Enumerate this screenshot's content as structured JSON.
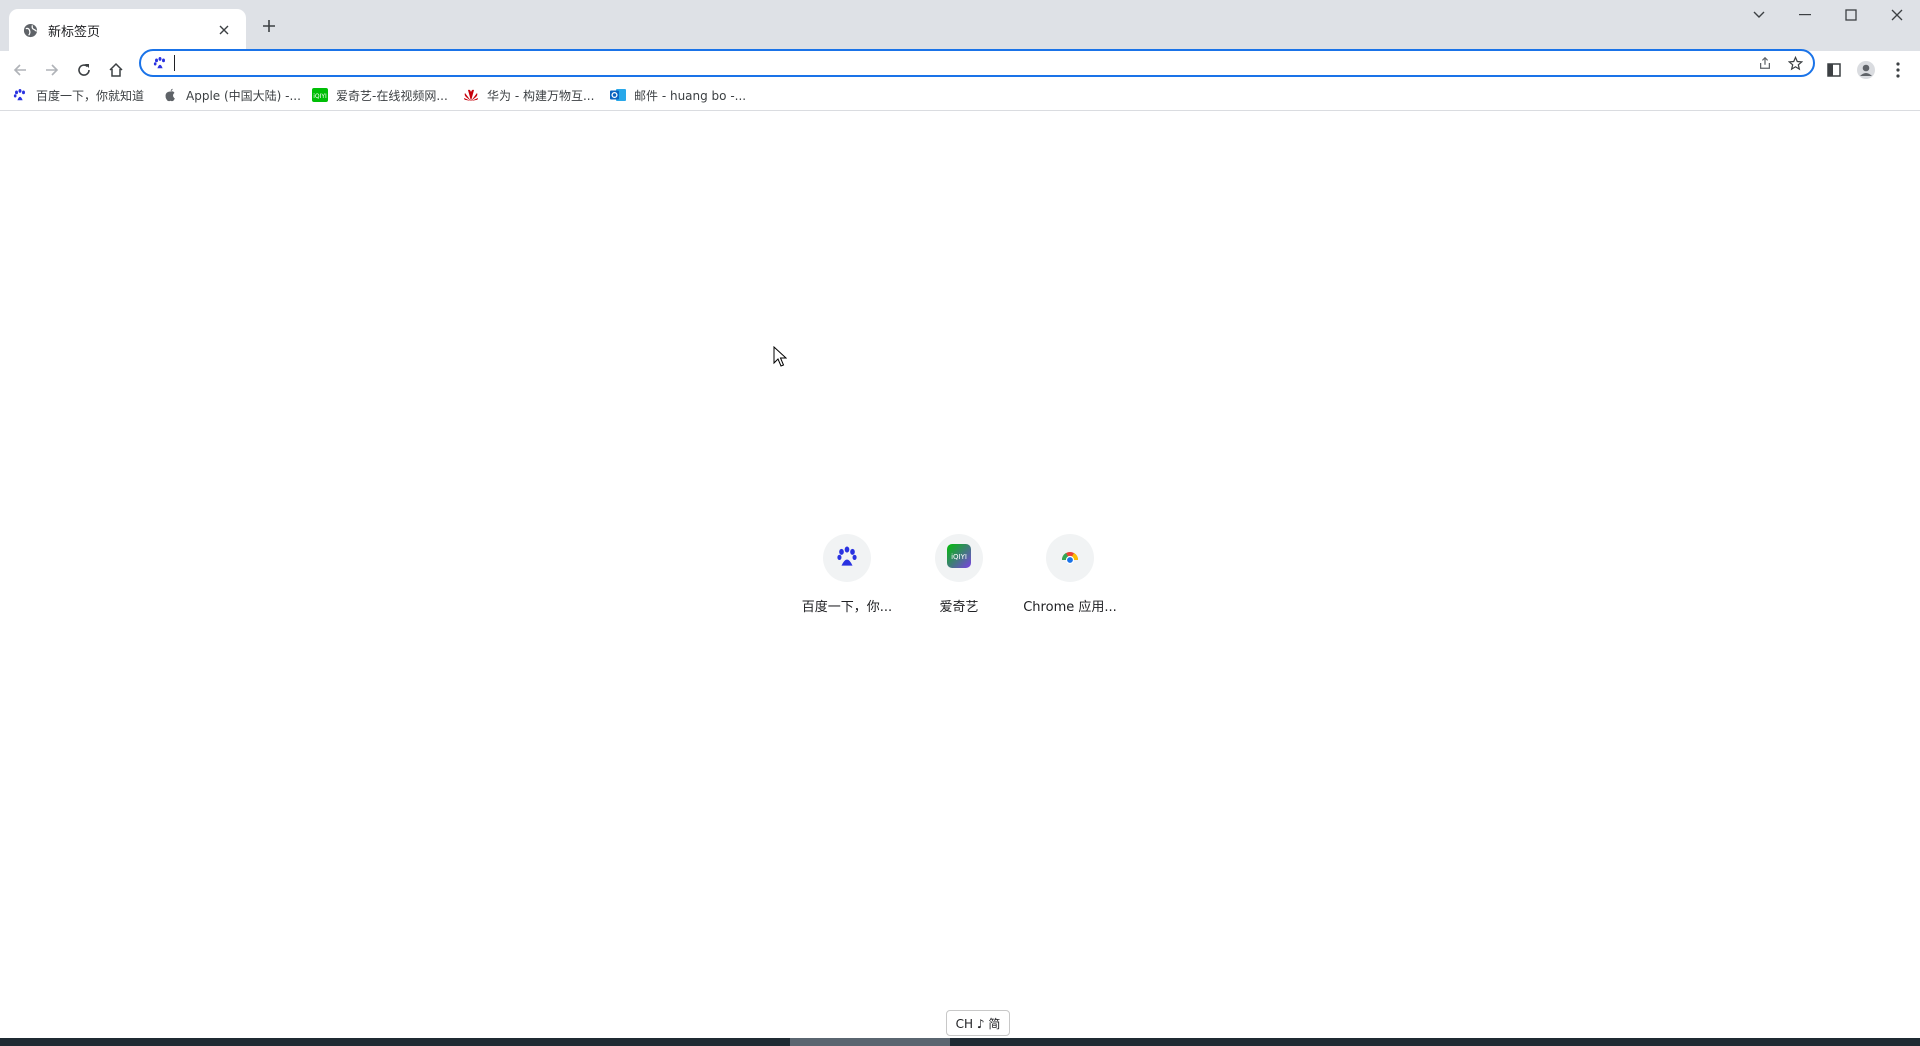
{
  "tab": {
    "title": "新标签页"
  },
  "omnibox": {
    "value": "",
    "placeholder": ""
  },
  "bookmarks": [
    {
      "label": "百度一下，你就知道",
      "icon": "baidu-paw-icon"
    },
    {
      "label": "Apple (中国大陆) -...",
      "icon": "apple-icon"
    },
    {
      "label": "爱奇艺-在线视频网...",
      "icon": "iqiyi-icon"
    },
    {
      "label": "华为 - 构建万物互...",
      "icon": "huawei-icon"
    },
    {
      "label": "邮件 - huang bo -...",
      "icon": "outlook-icon"
    }
  ],
  "shortcuts": [
    {
      "label": "百度一下，你...",
      "icon": "baidu-paw-icon"
    },
    {
      "label": "爱奇艺",
      "icon": "iqiyi-icon"
    },
    {
      "label": "Chrome 应用...",
      "icon": "chrome-web-store-icon"
    }
  ],
  "ime": {
    "label": "CH ♪ 简"
  },
  "colors": {
    "accent": "#1a73e8",
    "tabstrip": "#dee1e6",
    "baidu": "#2932e1",
    "iqiyi": "#00be06",
    "huawei": "#c7000b"
  }
}
